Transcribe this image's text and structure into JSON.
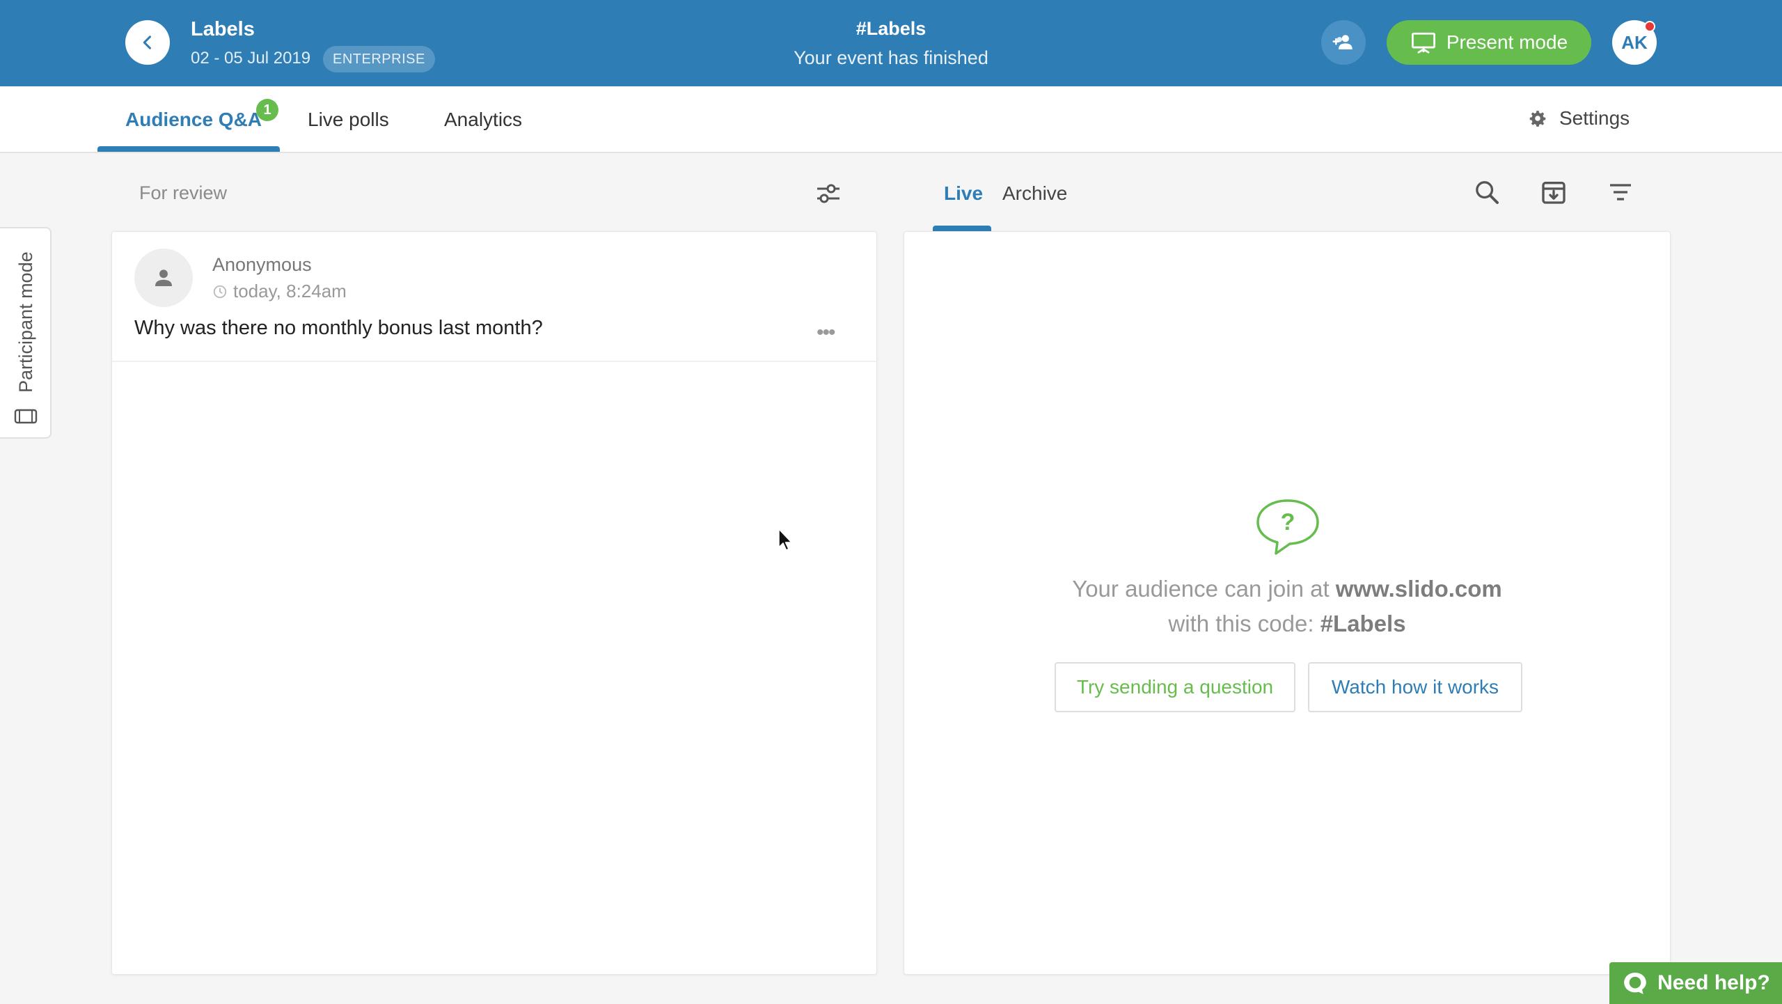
{
  "header": {
    "event_title": "Labels",
    "event_dates": "02 - 05 Jul 2019",
    "plan_badge": "ENTERPRISE",
    "event_code": "#Labels",
    "event_status": "Your event has finished",
    "present_label": "Present mode",
    "user_initials": "AK",
    "accent_color": "#2f7db5",
    "present_color": "#66bd4d"
  },
  "tabs": {
    "items": [
      {
        "label": "Audience Q&A",
        "active": true,
        "badge": "1"
      },
      {
        "label": "Live polls",
        "active": false
      },
      {
        "label": "Analytics",
        "active": false
      }
    ],
    "settings_label": "Settings"
  },
  "sidebar": {
    "participant_mode_label": "Participant mode"
  },
  "review_panel": {
    "title": "For review",
    "questions": [
      {
        "author": "Anonymous",
        "time": "today, 8:24am",
        "text": "Why was there no monthly bonus last month?"
      }
    ]
  },
  "live_panel": {
    "tabs": [
      "Live",
      "Archive"
    ],
    "active_tab": "Live",
    "empty_state": {
      "line1_prefix": "Your audience can join at ",
      "line1_bold": "www.slido.com",
      "line2_prefix": "with this code: ",
      "line2_bold": "#Labels",
      "try_button": "Try sending a question",
      "watch_button": "Watch how it works"
    }
  },
  "help": {
    "label": "Need help?"
  }
}
